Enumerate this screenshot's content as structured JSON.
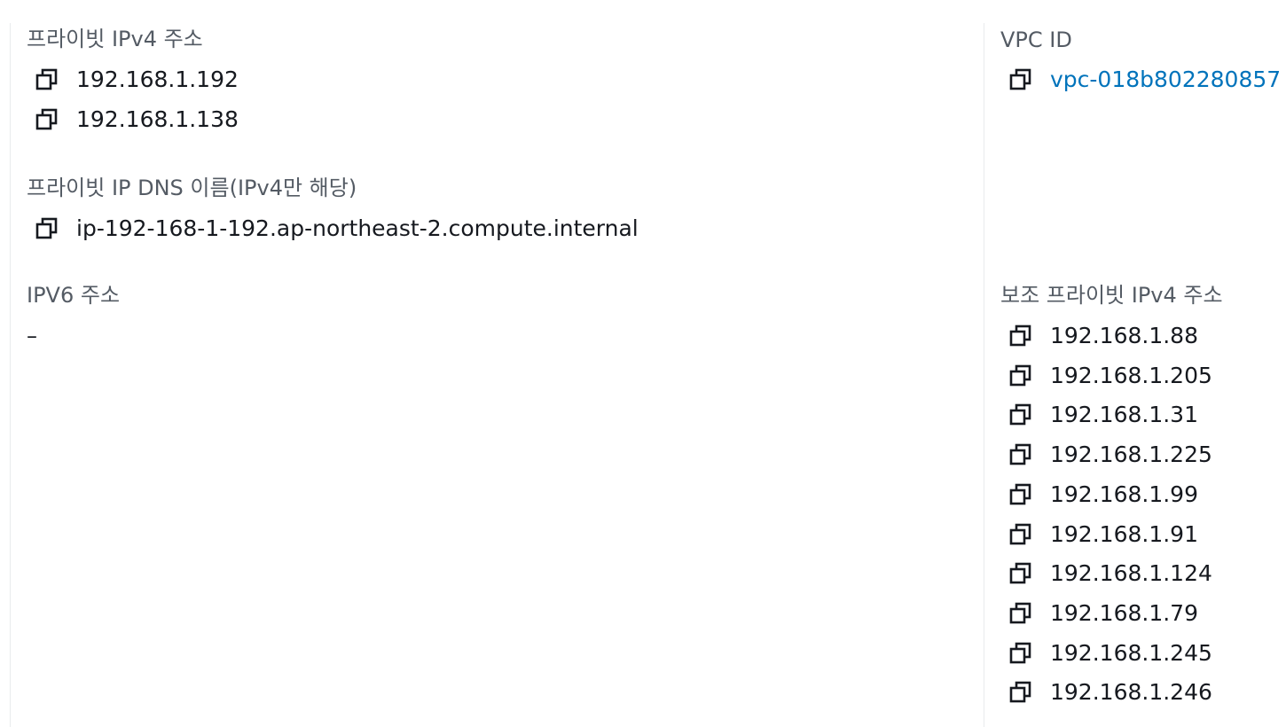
{
  "private_ipv4": {
    "label": "프라이빗 IPv4 주소",
    "addresses": [
      "192.168.1.192",
      "192.168.1.138"
    ]
  },
  "private_dns": {
    "label": "프라이빗 IP DNS 이름(IPv4만 해당)",
    "value": "ip-192-168-1-192.ap-northeast-2.compute.internal"
  },
  "ipv6": {
    "label": "IPV6 주소",
    "value": "–"
  },
  "vpc": {
    "label": "VPC ID",
    "value": "vpc-018b802280857"
  },
  "secondary_private_ipv4": {
    "label": "보조 프라이빗 IPv4 주소",
    "addresses": [
      "192.168.1.88",
      "192.168.1.205",
      "192.168.1.31",
      "192.168.1.225",
      "192.168.1.99",
      "192.168.1.91",
      "192.168.1.124",
      "192.168.1.79",
      "192.168.1.245",
      "192.168.1.246"
    ]
  },
  "icons": {
    "copy": "copy-icon"
  },
  "colors": {
    "link": "#0073bb",
    "label": "#545b64",
    "text": "#16191f"
  }
}
